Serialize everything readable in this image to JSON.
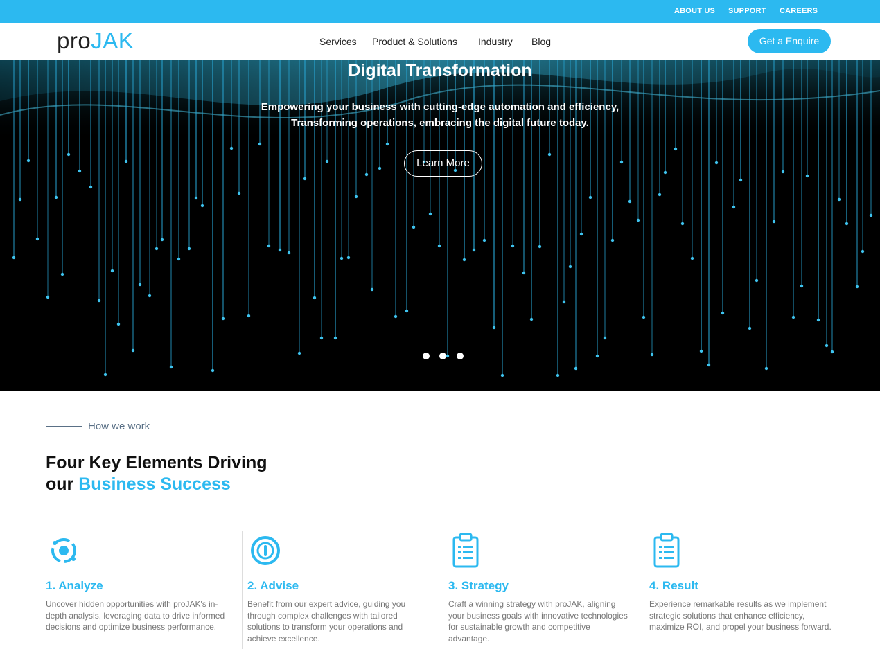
{
  "topbar": {
    "links": [
      "ABOUT US",
      "SUPPORT",
      "CAREERS"
    ]
  },
  "header": {
    "logo_part1": "pro",
    "logo_part2": "JAK",
    "nav": [
      "Services",
      "Product & Solutions",
      "Industry",
      "Blog"
    ],
    "cta_label": "Get a Enquire"
  },
  "hero": {
    "title": "Digital Transformation",
    "subtitle_line1": "Empowering your business with cutting-edge automation and efficiency,",
    "subtitle_line2": "Transforming operations, embracing the digital future today.",
    "button_label": "Learn More",
    "slide_count": 3
  },
  "how_we_work": {
    "kicker": "How we work",
    "heading_line1": "Four Key Elements Driving",
    "heading_line2_prefix": "our ",
    "heading_line2_accent": "Business Success",
    "steps": [
      {
        "icon": "analyze-icon",
        "title": "1. Analyze",
        "text": "Uncover hidden opportunities with proJAK's in-depth analysis, leveraging data to drive informed decisions and optimize business performance."
      },
      {
        "icon": "advise-icon",
        "title": "2. Advise",
        "text": "Benefit from our expert advice, guiding you through complex challenges with tailored solutions to transform your operations and achieve excellence."
      },
      {
        "icon": "clipboard-icon",
        "title": "3. Strategy",
        "text": "Craft a winning strategy with proJAK, aligning your business goals with innovative technologies for sustainable growth and competitive advantage."
      },
      {
        "icon": "clipboard-icon",
        "title": "4. Result",
        "text": "Experience remarkable results as we implement strategic solutions that enhance efficiency, maximize ROI, and propel your business forward."
      }
    ]
  },
  "colors": {
    "accent": "#2cb9f0",
    "text_dark": "#111111",
    "text_muted": "#777777",
    "hero_bg": "#000000"
  }
}
